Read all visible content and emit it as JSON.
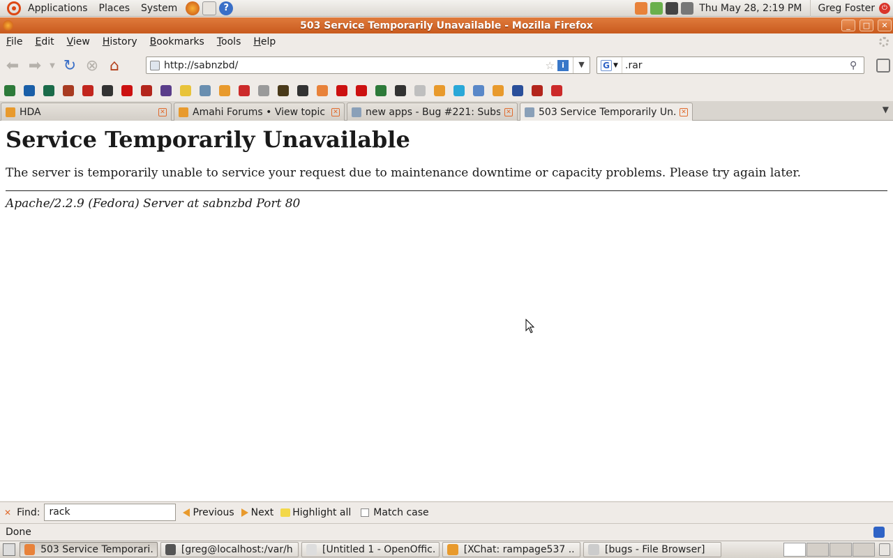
{
  "top_panel": {
    "menus": [
      "Applications",
      "Places",
      "System"
    ],
    "clock": "Thu May 28,  2:19 PM",
    "user": "Greg Foster"
  },
  "window": {
    "title": "503 Service Temporarily Unavailable - Mozilla Firefox",
    "controls": [
      "minimize-icon",
      "maximize-icon",
      "close-icon"
    ]
  },
  "menubar": {
    "items": [
      {
        "label": "File",
        "underline": "F",
        "rest": "ile"
      },
      {
        "label": "Edit",
        "underline": "E",
        "rest": "dit"
      },
      {
        "label": "View",
        "underline": "V",
        "rest": "iew"
      },
      {
        "label": "History",
        "underline": "H",
        "rest": "istory"
      },
      {
        "label": "Bookmarks",
        "underline": "B",
        "rest": "ookmarks"
      },
      {
        "label": "Tools",
        "underline": "T",
        "rest": "ools"
      },
      {
        "label": "Help",
        "underline": "H",
        "rest": "elp"
      }
    ]
  },
  "toolbar": {
    "url": "http://sabnzbd/",
    "search_value": ".rar"
  },
  "bookmark_colors": [
    "#2d7a3a",
    "#1a5fa8",
    "#1b6b4a",
    "#a83b22",
    "#c2261e",
    "#333333",
    "#cc1111",
    "#b3251c",
    "#5a3d8a",
    "#e8c33a",
    "#6a8fb0",
    "#e89a2d",
    "#cc2a2a",
    "#9a9a9a",
    "#4a3a1a",
    "#333333",
    "#e8823a",
    "#cc1111",
    "#cc1111",
    "#2d7a3a",
    "#333333",
    "#bfbfbf",
    "#e89a2d",
    "#2aa8d8",
    "#5a88c8",
    "#e89a2d",
    "#2a4f9a",
    "#b3251c",
    "#cc2a2a"
  ],
  "tabs": [
    {
      "label": "HDA",
      "color": "#e89a2d"
    },
    {
      "label": "Amahi Forums • View topic ...",
      "color": "#e89a2d"
    },
    {
      "label": "new apps - Bug #221: Subso...",
      "color": "#8aa0b8"
    },
    {
      "label": "503 Service Temporarily Un...",
      "color": "#8aa0b8",
      "selected": true
    }
  ],
  "page": {
    "heading": "Service Temporarily Unavailable",
    "message": "The server is temporarily unable to service your request due to maintenance downtime or capacity problems. Please try again later.",
    "address": "Apache/2.2.9 (Fedora) Server at sabnzbd Port 80"
  },
  "findbar": {
    "label": "Find:",
    "value": "rack",
    "previous": "Previous",
    "next": "Next",
    "highlight_all": "Highlight all",
    "match_case": "Match case"
  },
  "statusbar": {
    "text": "Done"
  },
  "taskbar": {
    "tasks": [
      {
        "label": "503 Service Temporari...",
        "color": "#e8823a",
        "active": true
      },
      {
        "label": "[greg@localhost:/var/h...",
        "color": "#555555"
      },
      {
        "label": "[Untitled 1 - OpenOffic...",
        "color": "#dddddd"
      },
      {
        "label": "[XChat: rampage537 ...",
        "color": "#e89a2d"
      },
      {
        "label": "[bugs - File Browser]",
        "color": "#cccccc"
      }
    ]
  }
}
